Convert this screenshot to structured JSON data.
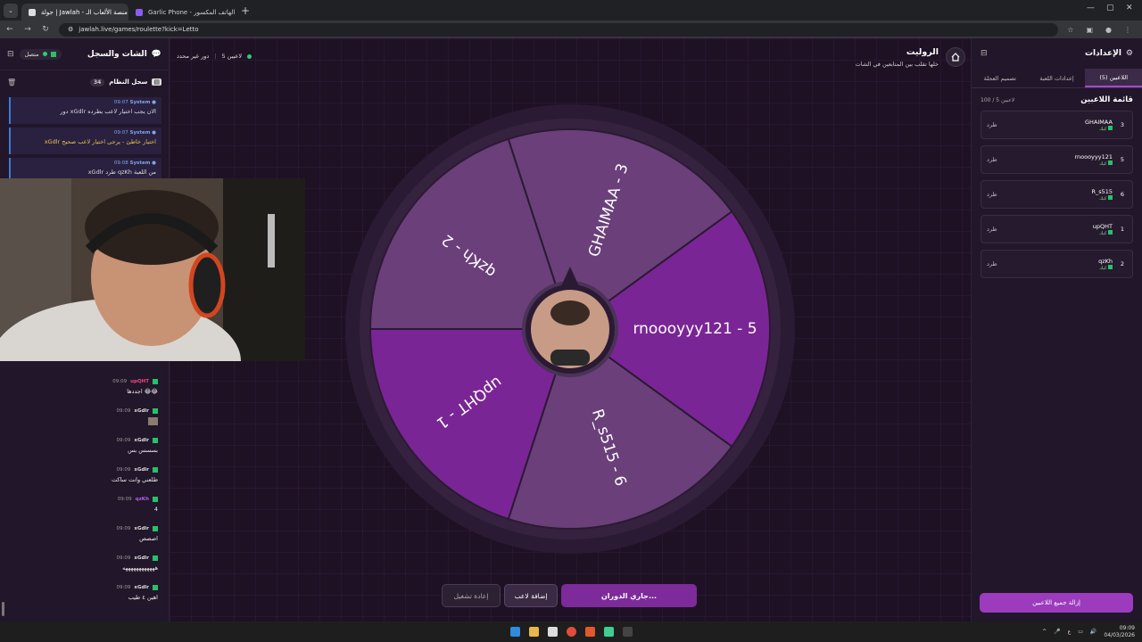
{
  "browser": {
    "tabs": [
      {
        "label": "جولة | Jawlah - منصة الألعاب الـ"
      },
      {
        "label": "Garlic Phone - الهاتف المكسور"
      }
    ],
    "url": "jawlah.live/games/roulette?kick=Letto"
  },
  "chat": {
    "title": "الشات والسجل",
    "connection": "متصل",
    "syslog_title": "سجل النظام",
    "syslog_count": "34",
    "system_messages": [
      {
        "user": "System",
        "time": "09:07",
        "text": "دور xGdlr الان يجب اختيار لاعب يطرده",
        "warn": false
      },
      {
        "user": "System",
        "time": "09:07",
        "text": "xGdlr اختيار خاطئ - يرجى اختيار لاعب صحيح",
        "warn": true
      },
      {
        "user": "System",
        "time": "09:08",
        "text": "xGdlr طرد qzKh من اللعبة",
        "warn": false
      }
    ],
    "messages": [
      {
        "user": "upQHT",
        "time": "09:09",
        "text": "اجددها 😂😂"
      },
      {
        "user": "xGdlr",
        "time": "09:09",
        "text": ""
      },
      {
        "user": "xGdlr",
        "time": "09:09",
        "text": "بسسس بس"
      },
      {
        "user": "xGdlr",
        "time": "09:09",
        "text": "طلعني وانت ساكت"
      },
      {
        "user": "qzKh",
        "time": "09:09",
        "text": "4"
      },
      {
        "user": "xGdlr",
        "time": "09:09",
        "text": "اصصص"
      },
      {
        "user": "xGdlr",
        "time": "09:09",
        "text": "ههههههههههههه"
      },
      {
        "user": "xGdlr",
        "time": "09:09",
        "text": "اهين ٤ طيب"
      }
    ]
  },
  "header": {
    "title": "الروليت",
    "subtitle": "خلها تقلب بين المتابعين في الشات",
    "players_count": "5 لاعبين",
    "round": "دور غير محدد"
  },
  "wheel": {
    "segments": [
      {
        "label": "qzKh - 2",
        "color": "#6a3f7a"
      },
      {
        "label": "GHAIMAA - 3",
        "color": "#6a3f7a"
      },
      {
        "label": "rnoooyyy121 - 5",
        "color": "#7a2595"
      },
      {
        "label": "R_s515 - 6",
        "color": "#6a3f7a"
      },
      {
        "label": "upQHT - 1",
        "color": "#7a2595"
      }
    ]
  },
  "controls": {
    "restart": "إعادة تشغيل",
    "add_player": "إضافة لاعب",
    "spinning": "جاري الدوران..."
  },
  "settings": {
    "title": "الإعدادات",
    "tabs": [
      "اللاعبين (5)",
      "إعدادات اللعبة",
      "تصميم العجلة"
    ],
    "players_title": "قائمة اللاعبين",
    "players_count": "100 / 5 لاعبين",
    "kick_label": "طرد",
    "platform": "كيك",
    "players": [
      {
        "num": "3",
        "name": "GHAIMAA"
      },
      {
        "num": "5",
        "name": "rnoooyyy121"
      },
      {
        "num": "6",
        "name": "R_s515"
      },
      {
        "num": "1",
        "name": "upQHT"
      },
      {
        "num": "2",
        "name": "qzKh"
      }
    ],
    "remove_all": "إزالة جميع اللاعبين"
  },
  "taskbar": {
    "lang": "ع",
    "time": "09:09",
    "date": "04/03/2026"
  },
  "colors": {
    "accent": "#9c3bbd",
    "kick_green": "#26c26b"
  }
}
